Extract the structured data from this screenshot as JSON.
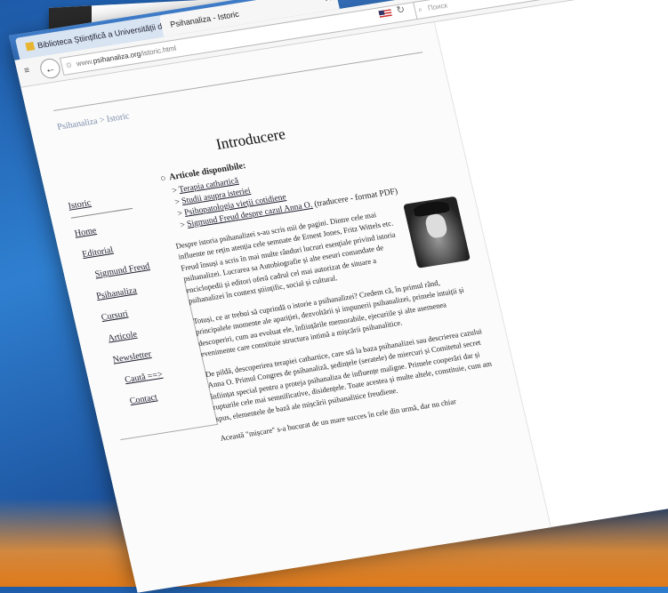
{
  "browser": {
    "tabs": [
      {
        "label": "Biblioteca Științifică a Universității de S...",
        "active": false
      },
      {
        "label": "Psihanaliza - Istoric",
        "active": true
      }
    ],
    "new_tab": "+",
    "url_prefix": "www.",
    "url_domain": "psihanaliza.org",
    "url_path": "/istoric.html",
    "search_placeholder": "Поиск",
    "icons": [
      "back-icon",
      "lock-icon",
      "flag-us-icon",
      "reload-icon",
      "search-icon",
      "download-icon",
      "home-icon",
      "star-icon",
      "clipboard-icon"
    ]
  },
  "page": {
    "breadcrumb": "Psihanaliza > Istoric",
    "title": "Introducere",
    "sidebar": {
      "current": "Istoric",
      "items": [
        "Home",
        "Editorial",
        "Sigmund Freud",
        "Psihanaliza",
        "Cursuri",
        "Articole",
        "Newsletter",
        "Caută ==>",
        "Contact"
      ]
    },
    "articles_heading": "Articole disponibile:",
    "articles": [
      {
        "label": "Terapia cathartică",
        "note": ""
      },
      {
        "label": "Studii asupra isteriei",
        "note": ""
      },
      {
        "label": "Psihopatologia vieții cotidiene",
        "note": ""
      },
      {
        "label": "Sigmund Freud despre cazul Anna O.",
        "note": "(traducere - format PDF)"
      }
    ],
    "paragraphs": [
      "Despre istoria psihanalizei s-au scris mii de pagini. Dintre cele mai influente ne rețin atenția cele semnate de Ernest Jones, Fritz Wittels etc. Freud însuși a scris în mai multe rânduri lucruri esențiale privind istoria psihanalizei. Lucrarea sa Autobiografie și alte eseuri comandate de enciclopedii și editori oferă cadrul cel mai autorizat de situare a psihanalizei în context științific, social și cultural.",
      "Totuși, ce ar trebui să cuprindă o istorie a psihanalizei? Credem că, în primul rând, principalele momente ale apariției, dezvoltării și impunerii psihanalizei, primele intuiții și descoperiri, cum au evoluat ele, înființările memorabile, ejecuriile și alte asemenea evenimente care constituie structura intimă a mișcării psihanalitice.",
      "De pildă, descoperirea terapiei cathartice, care stă la baza psihanalizei sau descrierea cazului Anna O. Primul Congres de psihanaliză, ședințele (seratele) de miercuri și Comitetul secret înființat special pentru a proteja psihanaliza de influențe maligne. Primele cooperări dar și rupturile cele mai semnificative, disidențele. Toate acestea și multe altele, constituie, cum am spus, elementele de bază ale mișcării psihanalitice freudiene.",
      "Această \"mișcare\" s-a bucurat de un mare succes în cele din urmă, dar nu chiar"
    ]
  }
}
